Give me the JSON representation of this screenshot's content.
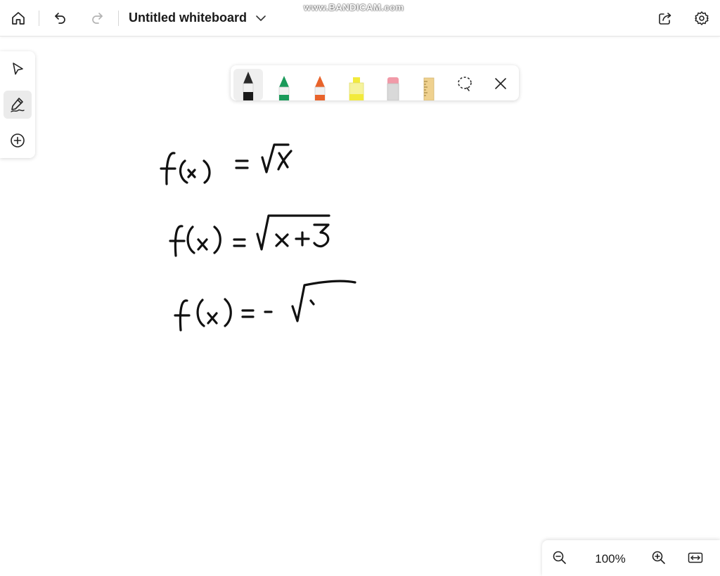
{
  "app": {
    "title": "Untitled whiteboard",
    "watermark": "www.BANDICAM.com"
  },
  "topbar": {
    "home_icon": "home-icon",
    "undo_icon": "undo-icon",
    "redo_icon": "redo-icon",
    "title_dropdown_icon": "chevron-down-icon",
    "share_icon": "share-icon",
    "settings_icon": "gear-icon"
  },
  "leftbar": {
    "tools": [
      {
        "icon": "select-pointer-icon",
        "active": false
      },
      {
        "icon": "inking-pen-icon",
        "active": true
      },
      {
        "icon": "add-circle-icon",
        "active": false
      }
    ]
  },
  "pen_tray": {
    "tools": [
      {
        "name": "black-pen",
        "color": "#1a1a1a",
        "active": true
      },
      {
        "name": "green-pen",
        "color": "#1a9a5a",
        "active": false
      },
      {
        "name": "orange-pen",
        "color": "#e8632b",
        "active": false
      },
      {
        "name": "yellow-highlighter",
        "color": "#f2ea3c",
        "active": false
      },
      {
        "name": "eraser",
        "color": "#f19aa8",
        "active": false
      },
      {
        "name": "ruler",
        "color": "#efd18f",
        "active": false
      }
    ],
    "lasso_icon": "lasso-select-icon",
    "close_icon": "close-icon"
  },
  "zoom": {
    "level": "100%",
    "zoom_out_icon": "zoom-out-icon",
    "zoom_in_icon": "zoom-in-icon",
    "fit_icon": "fit-to-screen-icon"
  }
}
